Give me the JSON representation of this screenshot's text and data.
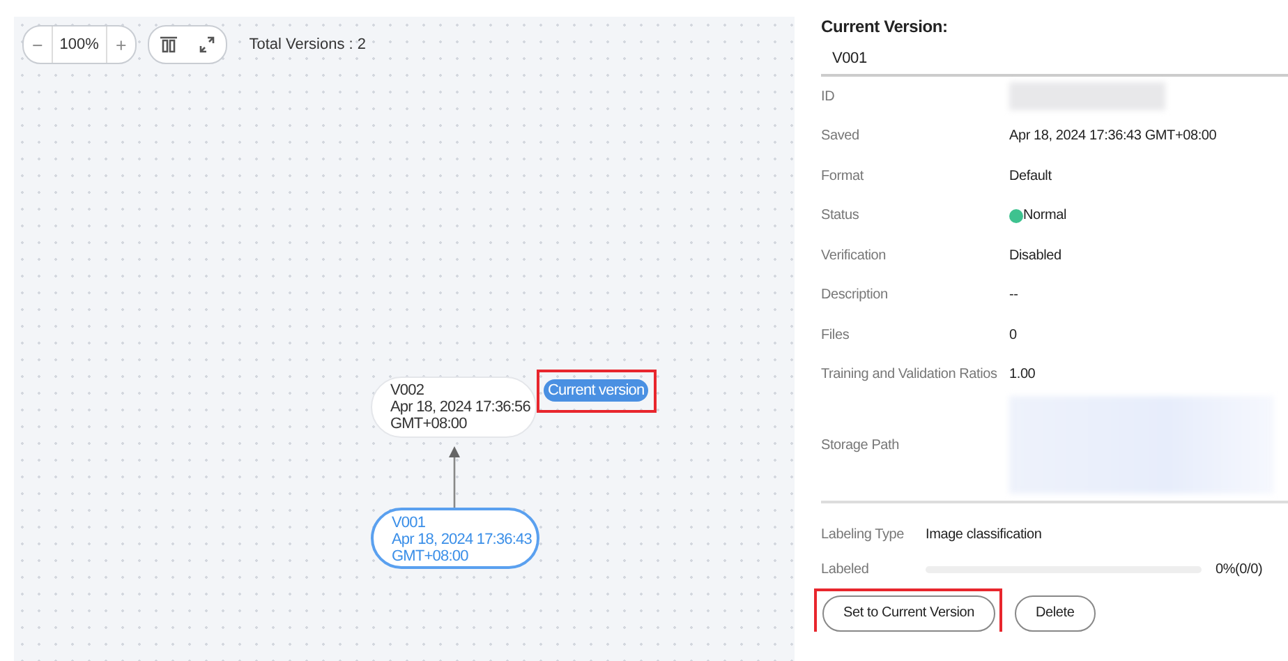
{
  "toolbar": {
    "zoom_out": "−",
    "zoom": "100%",
    "zoom_in": "+",
    "total_versions": "Total Versions : 2"
  },
  "graph": {
    "nodes": [
      {
        "name": "V002",
        "saved": "Apr 18, 2024 17:36:56",
        "tz": "GMT+08:00",
        "selected": false,
        "badge": "Current version",
        "badge_highlighted": true
      },
      {
        "name": "V001",
        "saved": "Apr 18, 2024 17:36:43",
        "tz": "GMT+08:00",
        "selected": true
      }
    ]
  },
  "details": {
    "title": "Current Version:",
    "version_tab": "V001",
    "rows": [
      {
        "kind": "redacted",
        "label": "ID"
      },
      {
        "kind": "text",
        "label": "Saved",
        "value": "Apr 18, 2024 17:36:43 GMT+08:00"
      },
      {
        "kind": "text",
        "label": "Format",
        "value": "Default"
      },
      {
        "kind": "status",
        "label": "Status",
        "value": "Normal",
        "color": "#3ec28f"
      },
      {
        "kind": "text",
        "label": "Verification",
        "value": "Disabled"
      },
      {
        "kind": "text",
        "label": "Description",
        "value": "--"
      },
      {
        "kind": "text",
        "label": "Files",
        "value": "0"
      },
      {
        "kind": "text",
        "label": "Training and Validation Ratios",
        "value": "1.00"
      },
      {
        "kind": "redacted_tall",
        "label": "Storage Path"
      }
    ],
    "labeling_type": {
      "label": "Labeling Type",
      "value": "Image classification"
    },
    "labeled": {
      "label": "Labeled",
      "level": 0,
      "reading": "0%(0/0)"
    },
    "buttons": [
      {
        "label": "Set to Current Version",
        "highlighted": true
      },
      {
        "label": "Delete",
        "highlighted": false
      }
    ]
  }
}
